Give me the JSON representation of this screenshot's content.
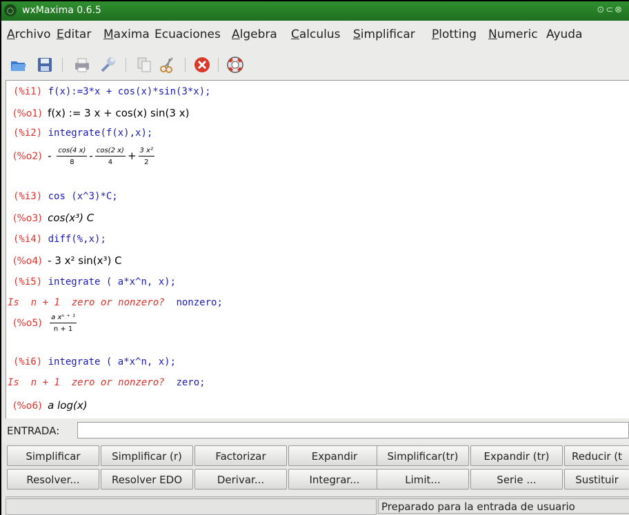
{
  "window": {
    "title": "wxMaxima 0.6.5"
  },
  "menu": [
    "Archivo",
    "Editar",
    "Maxima",
    "Ecuaciones",
    "Algebra",
    "Calculus",
    "Simplificar",
    "Plotting",
    "Numeric",
    "Ayuda"
  ],
  "toolbar": {
    "icons": [
      "open-icon",
      "save-icon",
      "print-icon",
      "config-icon",
      "copy-icon",
      "cut-icon",
      "interrupt-icon",
      "help-icon"
    ]
  },
  "worksheet": {
    "i1": {
      "label": "(%i1)",
      "text": "f(x):=3*x + cos(x)*sin(3*x);"
    },
    "o1": {
      "label": "(%o1)",
      "text": "f(x) := 3 x + cos(x) sin(3 x)"
    },
    "i2": {
      "label": "(%i2)",
      "text": "integrate(f(x),x);"
    },
    "o2": {
      "label": "(%o2)",
      "n1": "cos(4 x)",
      "d1": "8",
      "n2": "cos(2 x)",
      "d2": "4",
      "n3": "3 x²",
      "d3": "2"
    },
    "i3": {
      "label": "(%i3)",
      "text": "cos (x^3)*C;"
    },
    "o3": {
      "label": "(%o3)",
      "text": "cos(x³) C"
    },
    "i4": {
      "label": "(%i4)",
      "text": "diff(%,x);"
    },
    "o4": {
      "label": "(%o4)",
      "text": "- 3 x² sin(x³) C"
    },
    "i5": {
      "label": "(%i5)",
      "text": "integrate ( a*x^n, x);"
    },
    "q5": {
      "prefix": "Is",
      "expr": "n + 1",
      "question": "zero or nonzero?",
      "answer": "nonzero;"
    },
    "o5": {
      "label": "(%o5)",
      "num": "a xⁿ ⁺ ¹",
      "den": "n + 1"
    },
    "i6": {
      "label": "(%i6)",
      "text": "integrate ( a*x^n, x);"
    },
    "q6": {
      "prefix": "Is",
      "expr": "n + 1",
      "question": "zero or nonzero?",
      "answer": "zero;"
    },
    "o6": {
      "label": "(%o6)",
      "text": "a log(x)"
    }
  },
  "entry": {
    "label": "ENTRADA:",
    "value": ""
  },
  "buttons": {
    "row1": [
      "Simplificar",
      "Simplificar (r)",
      "Factorizar",
      "Expandir",
      "Simplificar(tr)",
      "Expandir (tr)",
      "Reducir (t"
    ],
    "row2": [
      "Resolver...",
      "Resolver EDO",
      "Derivar...",
      "Integrar...",
      "Limit...",
      "Serie ...",
      "Sustituir"
    ]
  },
  "status": {
    "text": "Preparado para la entrada de usuario"
  }
}
